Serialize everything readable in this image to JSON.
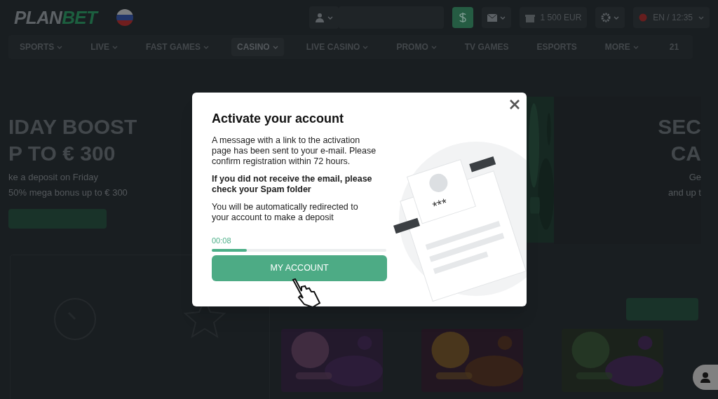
{
  "header": {
    "logo": {
      "first": "PLAN",
      "second": "BET"
    },
    "bonus": "1 500 EUR",
    "language": "EN / 12:35"
  },
  "nav": [
    {
      "label": "SPORTS",
      "dropdown": true,
      "selected": false
    },
    {
      "label": "LIVE",
      "dropdown": true,
      "selected": false
    },
    {
      "label": "FAST GAMES",
      "dropdown": true,
      "selected": false
    },
    {
      "label": "CASINO",
      "dropdown": true,
      "selected": true
    },
    {
      "label": "LIVE CASINO",
      "dropdown": true,
      "selected": false
    },
    {
      "label": "PROMO",
      "dropdown": true,
      "selected": false
    },
    {
      "label": "TV GAMES",
      "dropdown": false,
      "selected": false
    },
    {
      "label": "ESPORTS",
      "dropdown": false,
      "selected": false
    },
    {
      "label": "MORE",
      "dropdown": true,
      "selected": false
    }
  ],
  "nav_count": "21",
  "banner_left": {
    "title": [
      "IDAY BOOST",
      "P TO € 300"
    ],
    "text": [
      "ke a deposit on Friday",
      "50% mega bonus up to € 300"
    ]
  },
  "banner_right": {
    "title": [
      "SEC",
      "CA"
    ],
    "text": [
      "Ge",
      "and up t"
    ]
  },
  "dialog": {
    "title": "Activate your account",
    "paragraphs": [
      {
        "text": "A message with a link to the activation page has been sent to your e-mail. Please confirm registration within 72 hours.",
        "bold": false
      },
      {
        "text": "If you did not receive the email, please check your Spam folder",
        "bold": true
      },
      {
        "text": "You will be automatically redirected to your account to make a deposit",
        "bold": false
      }
    ],
    "illustration_mask": "***",
    "timer": "00:08",
    "progress": {
      "level": 0.2
    },
    "button": "MY ACCOUNT"
  }
}
